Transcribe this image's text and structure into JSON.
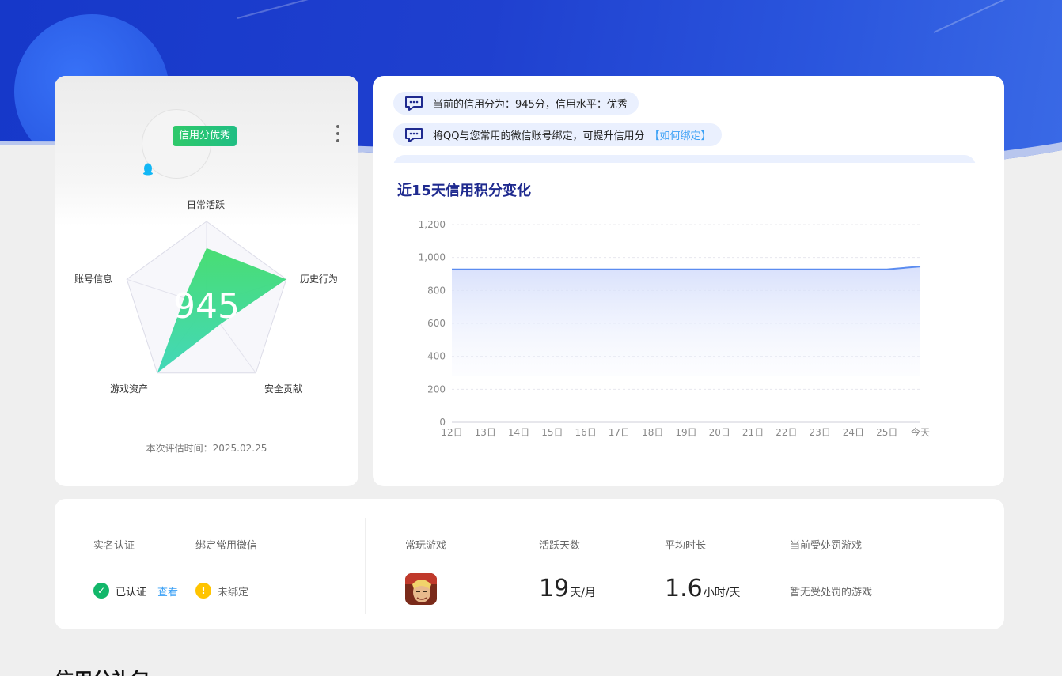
{
  "profile": {
    "badge": "信用分优秀",
    "score": "945",
    "radar_axes": [
      "日常活跃",
      "历史行为",
      "安全贡献",
      "游戏资产",
      "账号信息"
    ],
    "radar_values": [
      0.68,
      1.0,
      0.28,
      1.0,
      0.28
    ],
    "eval_time": "本次评估时间：2025.02.25"
  },
  "notices": [
    {
      "text": "当前的信用分为：945分，信用水平：优秀",
      "link": ""
    },
    {
      "text": "将QQ与您常用的微信账号绑定，可提升信用分",
      "link": "【如何绑定】"
    }
  ],
  "chart_data": {
    "type": "area",
    "title": "近15天信用积分变化",
    "x": [
      "12日",
      "13日",
      "14日",
      "15日",
      "16日",
      "17日",
      "18日",
      "19日",
      "20日",
      "21日",
      "22日",
      "23日",
      "24日",
      "25日",
      "今天"
    ],
    "values": [
      928,
      928,
      928,
      928,
      928,
      928,
      928,
      928,
      928,
      928,
      928,
      928,
      928,
      928,
      945
    ],
    "ylim": [
      0,
      1200
    ],
    "yticks": [
      "0",
      "200",
      "400",
      "600",
      "800",
      "1,000",
      "1,200"
    ],
    "ytick_values": [
      0,
      200,
      400,
      600,
      800,
      1000,
      1200
    ],
    "grid": true,
    "line_color": "#5b8cf0"
  },
  "account": {
    "realname_label": "实名认证",
    "wechat_label": "绑定常用微信",
    "realname_status": "已认证",
    "view_link": "查看",
    "wechat_status": "未绑定",
    "games_label": "常玩游戏",
    "active_days_label": "活跃天数",
    "active_days_value": "19",
    "active_days_unit": "天/月",
    "avg_time_label": "平均时长",
    "avg_time_value": "1.6",
    "avg_time_unit": "小时/天",
    "punish_label": "当前受处罚游戏",
    "punish_value": "暂无受处罚的游戏"
  },
  "colors": {
    "accent": "#1f40cf",
    "success": "#12b76a",
    "warning": "#ffc400",
    "link": "#3aa0f5"
  },
  "section_title": "信用分礼包"
}
